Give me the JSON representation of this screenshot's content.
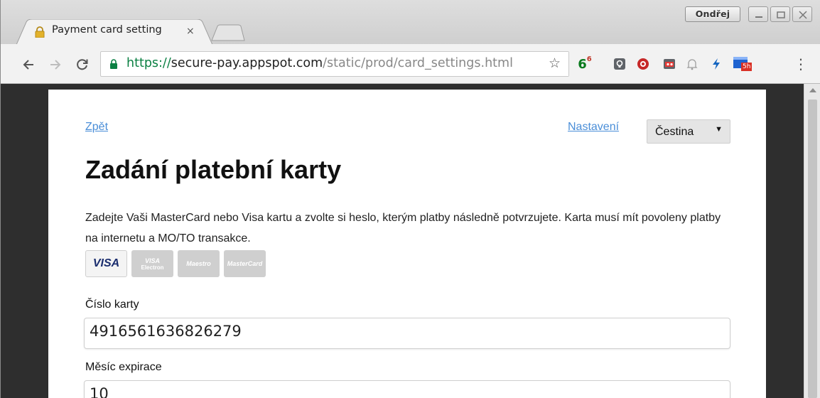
{
  "browser": {
    "tab_title": "Payment card setting",
    "tab_close": "×",
    "user_name": "Ondřej",
    "url_scheme": "https://",
    "url_host": "secure-pay.appspot.com",
    "url_path": "/static/prod/card_settings.html",
    "star": "☆",
    "ext_badge_6": "6",
    "ext_badge_6_sup": "6",
    "ext_badge_5h": "5h",
    "menu": "⋮"
  },
  "page": {
    "back_link": "Zpět",
    "settings_link": "Nastavení",
    "language": "Čestina",
    "language_arrow": "▼",
    "title": "Zadání platební karty",
    "description": "Zadejte Vaši MasterCard nebo Visa kartu a zvolte si heslo, kterým platby následně potvrzujete. Karta musí mít povoleny platby na internetu a MO/TO transakce.",
    "cards": {
      "visa": "VISA",
      "visa_electron_top": "VISA",
      "visa_electron_bottom": "Electron",
      "maestro": "Maestro",
      "mastercard": "MasterCard"
    },
    "card_number_label": "Číslo karty",
    "card_number_value": "4916561636826279",
    "expiry_month_label": "Měsíc expirace",
    "expiry_month_value": "10"
  }
}
